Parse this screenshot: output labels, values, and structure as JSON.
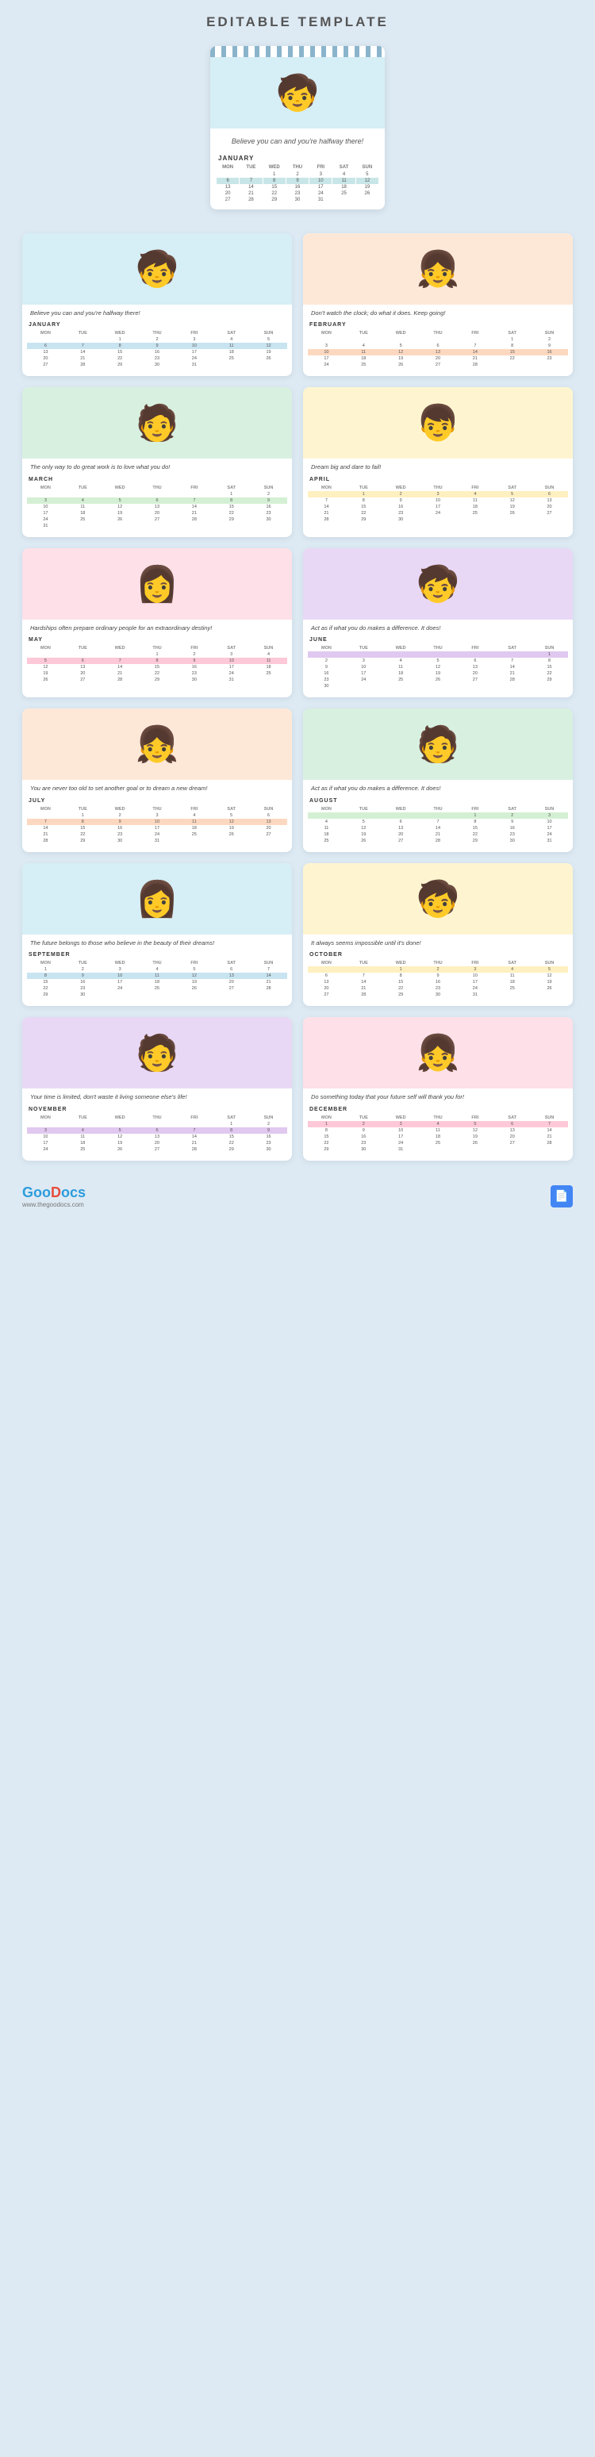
{
  "pageTitle": "EDITABLE TEMPLATE",
  "heroCalendar": {
    "quote": "Believe you can and you're halfway there!",
    "month": "JANUARY",
    "days": [
      "MON",
      "TUE",
      "WED",
      "THU",
      "FRI",
      "SAT",
      "SUN"
    ],
    "weeks": [
      [
        "",
        "",
        "1",
        "2",
        "3",
        "4",
        "5"
      ],
      [
        "6",
        "7",
        "8",
        "9",
        "10",
        "11",
        "12"
      ],
      [
        "13",
        "14",
        "15",
        "16",
        "17",
        "18",
        "19"
      ],
      [
        "20",
        "21",
        "22",
        "23",
        "24",
        "25",
        "26"
      ],
      [
        "27",
        "28",
        "29",
        "30",
        "31",
        "",
        ""
      ]
    ],
    "highlightRow": 1
  },
  "months": [
    {
      "id": "january",
      "label": "JANUARY",
      "quote": "Believe you can and you're halfway there!",
      "bg": "bg-blue",
      "char": "🧒",
      "hlClass": "hl-blue",
      "hlRow": 1,
      "days": [
        "MON",
        "TUE",
        "WED",
        "THU",
        "FRI",
        "SAT",
        "SUN"
      ],
      "weeks": [
        [
          "",
          "",
          "1",
          "2",
          "3",
          "4",
          "5"
        ],
        [
          "6",
          "7",
          "8",
          "9",
          "10",
          "11",
          "12"
        ],
        [
          "13",
          "14",
          "15",
          "16",
          "17",
          "18",
          "19"
        ],
        [
          "20",
          "21",
          "22",
          "23",
          "24",
          "25",
          "26"
        ],
        [
          "27",
          "28",
          "29",
          "30",
          "31",
          "",
          ""
        ]
      ]
    },
    {
      "id": "february",
      "label": "FEBRUARY",
      "quote": "Don't watch the clock; do what it does. Keep going!",
      "bg": "bg-peach",
      "char": "👧",
      "hlClass": "hl-peach",
      "hlRow": 2,
      "days": [
        "MON",
        "TUE",
        "WED",
        "THU",
        "FRI",
        "SAT",
        "SUN"
      ],
      "weeks": [
        [
          "",
          "",
          "",
          "",
          "",
          "1",
          "2"
        ],
        [
          "3",
          "4",
          "5",
          "6",
          "7",
          "8",
          "9"
        ],
        [
          "10",
          "11",
          "12",
          "13",
          "14",
          "15",
          "16"
        ],
        [
          "17",
          "18",
          "19",
          "20",
          "21",
          "22",
          "23"
        ],
        [
          "24",
          "25",
          "26",
          "27",
          "28",
          "",
          ""
        ]
      ]
    },
    {
      "id": "march",
      "label": "MARCH",
      "quote": "The only way to do great work is to love what you do!",
      "bg": "bg-green",
      "char": "🧑",
      "hlClass": "hl-green",
      "hlRow": 2,
      "days": [
        "MON",
        "TUE",
        "WED",
        "THU",
        "FRI",
        "SAT",
        "SUN"
      ],
      "weeks": [
        [
          "",
          "",
          "",
          "",
          "",
          "1",
          "2"
        ],
        [
          "3",
          "4",
          "5",
          "6",
          "7",
          "8",
          "9"
        ],
        [
          "10",
          "11",
          "12",
          "13",
          "14",
          "15",
          "16"
        ],
        [
          "17",
          "18",
          "19",
          "20",
          "21",
          "22",
          "23"
        ],
        [
          "24",
          "25",
          "26",
          "27",
          "28",
          "29",
          "30"
        ],
        [
          "31",
          "",
          "",
          "",
          "",
          "",
          ""
        ]
      ]
    },
    {
      "id": "april",
      "label": "APRIL",
      "quote": "Dream big and dare to fail!",
      "bg": "bg-yellow",
      "char": "👦",
      "hlClass": "hl-yellow",
      "hlRow": 1,
      "days": [
        "MON",
        "TUE",
        "WED",
        "THU",
        "FRI",
        "SAT",
        "SUN"
      ],
      "weeks": [
        [
          "",
          "1",
          "2",
          "3",
          "4",
          "5",
          "6"
        ],
        [
          "7",
          "8",
          "9",
          "10",
          "11",
          "12",
          "13"
        ],
        [
          "14",
          "15",
          "16",
          "17",
          "18",
          "19",
          "20"
        ],
        [
          "21",
          "22",
          "23",
          "24",
          "25",
          "26",
          "27"
        ],
        [
          "28",
          "29",
          "30",
          "",
          "",
          "",
          ""
        ]
      ]
    },
    {
      "id": "may",
      "label": "MAY",
      "quote": "Hardships often prepare ordinary people for an extraordinary destiny!",
      "bg": "bg-pink",
      "char": "👩",
      "hlClass": "hl-pink",
      "hlRow": 2,
      "days": [
        "MON",
        "TUE",
        "WED",
        "THU",
        "FRI",
        "SAT",
        "SUN"
      ],
      "weeks": [
        [
          "",
          "",
          "",
          "1",
          "2",
          "3",
          "4"
        ],
        [
          "5",
          "6",
          "7",
          "8",
          "9",
          "10",
          "11"
        ],
        [
          "12",
          "13",
          "14",
          "15",
          "16",
          "17",
          "18"
        ],
        [
          "19",
          "20",
          "21",
          "22",
          "23",
          "24",
          "25"
        ],
        [
          "26",
          "27",
          "28",
          "29",
          "30",
          "31",
          ""
        ]
      ]
    },
    {
      "id": "june",
      "label": "JUNE",
      "quote": "Act as if what you do makes a difference. It does!",
      "bg": "bg-lavender",
      "char": "🧒",
      "hlClass": "hl-lavender",
      "hlRow": 1,
      "days": [
        "MON",
        "TUE",
        "WED",
        "THU",
        "FRI",
        "SAT",
        "SUN"
      ],
      "weeks": [
        [
          "",
          "",
          "",
          "",
          "",
          "",
          "1"
        ],
        [
          "2",
          "3",
          "4",
          "5",
          "6",
          "7",
          "8"
        ],
        [
          "9",
          "10",
          "11",
          "12",
          "13",
          "14",
          "15"
        ],
        [
          "16",
          "17",
          "18",
          "19",
          "20",
          "21",
          "22"
        ],
        [
          "23",
          "24",
          "25",
          "26",
          "27",
          "28",
          "29"
        ],
        [
          "30",
          "",
          "",
          "",
          "",
          "",
          ""
        ]
      ]
    },
    {
      "id": "july",
      "label": "JULY",
      "quote": "You are never too old to set another goal or to dream a new dream!",
      "bg": "bg-peach",
      "char": "👧",
      "hlClass": "hl-peach",
      "hlRow": 2,
      "days": [
        "MON",
        "TUE",
        "WED",
        "THU",
        "FRI",
        "SAT",
        "SUN"
      ],
      "weeks": [
        [
          "",
          "1",
          "2",
          "3",
          "4",
          "5",
          "6"
        ],
        [
          "7",
          "8",
          "9",
          "10",
          "11",
          "12",
          "13"
        ],
        [
          "14",
          "15",
          "16",
          "17",
          "18",
          "19",
          "20"
        ],
        [
          "21",
          "22",
          "23",
          "24",
          "25",
          "26",
          "27"
        ],
        [
          "28",
          "29",
          "30",
          "31",
          "",
          "",
          ""
        ]
      ]
    },
    {
      "id": "august",
      "label": "AUGUST",
      "quote": "Act as if what you do makes a difference. It does!",
      "bg": "bg-green",
      "char": "🧑",
      "hlClass": "hl-green",
      "hlRow": 1,
      "days": [
        "MON",
        "TUE",
        "WED",
        "THU",
        "FRI",
        "SAT",
        "SUN"
      ],
      "weeks": [
        [
          "",
          "",
          "",
          "",
          "1",
          "2",
          "3"
        ],
        [
          "4",
          "5",
          "6",
          "7",
          "8",
          "9",
          "10"
        ],
        [
          "11",
          "12",
          "13",
          "14",
          "15",
          "16",
          "17"
        ],
        [
          "18",
          "19",
          "20",
          "21",
          "22",
          "23",
          "24"
        ],
        [
          "25",
          "26",
          "27",
          "28",
          "29",
          "30",
          "31"
        ]
      ]
    },
    {
      "id": "september",
      "label": "SEPTEMBER",
      "quote": "The future belongs to those who believe in the beauty of their dreams!",
      "bg": "bg-blue",
      "char": "👩",
      "hlClass": "hl-blue",
      "hlRow": 2,
      "days": [
        "MON",
        "TUE",
        "WED",
        "THU",
        "FRI",
        "SAT",
        "SUN"
      ],
      "weeks": [
        [
          "1",
          "2",
          "3",
          "4",
          "5",
          "6",
          "7"
        ],
        [
          "8",
          "9",
          "10",
          "11",
          "12",
          "13",
          "14"
        ],
        [
          "15",
          "16",
          "17",
          "18",
          "19",
          "20",
          "21"
        ],
        [
          "22",
          "23",
          "24",
          "25",
          "26",
          "27",
          "28"
        ],
        [
          "29",
          "30",
          "",
          "",
          "",
          "",
          ""
        ]
      ]
    },
    {
      "id": "october",
      "label": "OCTOBER",
      "quote": "It always seems impossible until it's done!",
      "bg": "bg-yellow",
      "char": "🧒",
      "hlClass": "hl-yellow",
      "hlRow": 1,
      "days": [
        "MON",
        "TUE",
        "WED",
        "THU",
        "FRI",
        "SAT",
        "SUN"
      ],
      "weeks": [
        [
          "",
          "",
          "1",
          "2",
          "3",
          "4",
          "5"
        ],
        [
          "6",
          "7",
          "8",
          "9",
          "10",
          "11",
          "12"
        ],
        [
          "13",
          "14",
          "15",
          "16",
          "17",
          "18",
          "19"
        ],
        [
          "20",
          "21",
          "22",
          "23",
          "24",
          "25",
          "26"
        ],
        [
          "27",
          "28",
          "29",
          "30",
          "31",
          "",
          ""
        ]
      ]
    },
    {
      "id": "november",
      "label": "NOVEMBER",
      "quote": "Your time is limited, don't waste it living someone else's life!",
      "bg": "bg-lavender",
      "char": "🧑",
      "hlClass": "hl-lavender",
      "hlRow": 2,
      "days": [
        "MON",
        "TUE",
        "WED",
        "THU",
        "FRI",
        "SAT",
        "SUN"
      ],
      "weeks": [
        [
          "",
          "",
          "",
          "",
          "",
          "1",
          "2"
        ],
        [
          "3",
          "4",
          "5",
          "6",
          "7",
          "8",
          "9"
        ],
        [
          "10",
          "11",
          "12",
          "13",
          "14",
          "15",
          "16"
        ],
        [
          "17",
          "18",
          "19",
          "20",
          "21",
          "22",
          "23"
        ],
        [
          "24",
          "25",
          "26",
          "27",
          "28",
          "29",
          "30"
        ]
      ]
    },
    {
      "id": "december",
      "label": "DECEMBER",
      "quote": "Do something today that your future self will thank you for!",
      "bg": "bg-pink",
      "char": "👧",
      "hlClass": "hl-pink",
      "hlRow": 1,
      "days": [
        "MON",
        "TUE",
        "WED",
        "THU",
        "FRI",
        "SAT",
        "SUN"
      ],
      "weeks": [
        [
          "1",
          "2",
          "3",
          "4",
          "5",
          "6",
          "7"
        ],
        [
          "8",
          "9",
          "10",
          "11",
          "12",
          "13",
          "14"
        ],
        [
          "15",
          "16",
          "17",
          "18",
          "19",
          "20",
          "21"
        ],
        [
          "22",
          "23",
          "24",
          "25",
          "26",
          "27",
          "28"
        ],
        [
          "29",
          "30",
          "31",
          "",
          "",
          "",
          ""
        ]
      ]
    }
  ],
  "footer": {
    "logo": "GooDocs",
    "logoHighlight": "Goo",
    "subtitle": "www.thegoodocs.com",
    "docIcon": "📄"
  }
}
